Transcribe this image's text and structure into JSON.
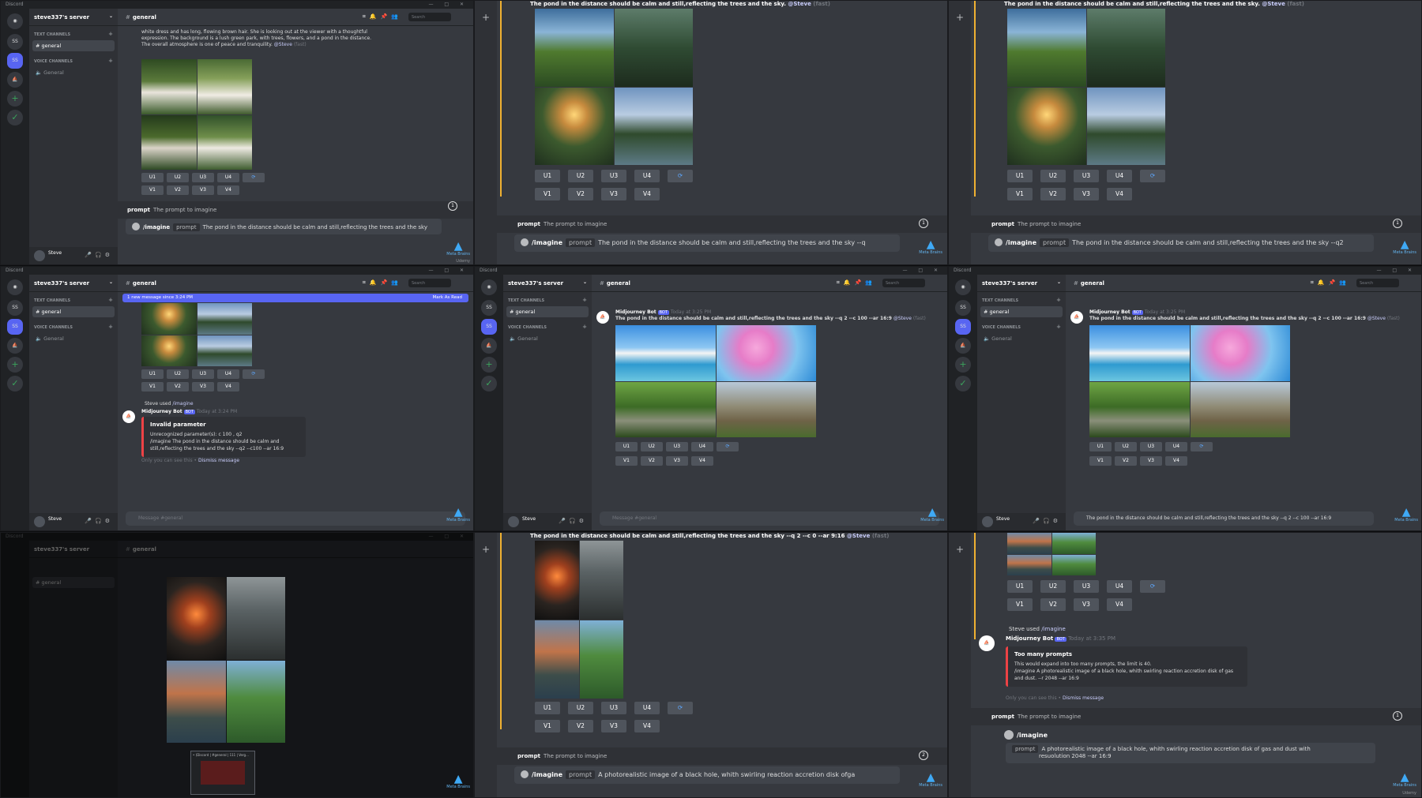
{
  "app_name": "Discord",
  "server": "steve337's server",
  "server_abbr": "SS",
  "channel": "general",
  "categories": {
    "text": "TEXT CHANNELS",
    "voice": "VOICE CHANNELS"
  },
  "voice_channel": "General",
  "user": "Steve",
  "search_placeholder": "Search",
  "buttons": {
    "u": [
      "U1",
      "U2",
      "U3",
      "U4"
    ],
    "v": [
      "V1",
      "V2",
      "V3",
      "V4"
    ]
  },
  "prompt_popup": {
    "label": "prompt",
    "desc": "The prompt to imagine"
  },
  "slash": "/imagine",
  "pill": "prompt",
  "brand": "Meta Brains",
  "udemy": "Udemy",
  "panel1": {
    "msg_text": "white dress and has long, flowing brown hair. She is looking out at the viewer with a thoughtful expression. The background is a lush green park, with trees, flowers, and a pond in the distance. The overall atmosphere is one of peace and tranquility.",
    "mention": "@Steve",
    "speed": "(fast)",
    "input": "The pond in the distance should be calm and still,reflecting the trees and the sky",
    "badge": "1"
  },
  "panel2": {
    "header": "The pond in the distance should be calm and still,reflecting the trees and the sky.",
    "mention": "@Steve",
    "speed": "(fast)",
    "input": "The pond in the distance should be calm and still,reflecting the trees and the sky --q",
    "badge": "1"
  },
  "panel3": {
    "header": "The pond in the distance should be calm and still,reflecting the trees and the sky.",
    "mention": "@Steve",
    "speed": "(fast)",
    "input": "The pond in the distance should be calm and still,reflecting the trees and the sky --q2",
    "badge": "1"
  },
  "panel4": {
    "new_messages": "1 new message since 3:24 PM",
    "mark_read": "Mark As Read",
    "used_by": "Steve used",
    "used_cmd": "/imagine",
    "bot": "Midjourney Bot",
    "bot_badge": "BOT",
    "time": "Today at 3:24 PM",
    "embed_title": "Invalid parameter",
    "embed_line1": "Unrecognized parameter(s): c 100 , q2",
    "embed_line2": "/imagine The pond in the distance should be calm and still,reflecting the trees and the sky --q2 --c100 --ar 16:9",
    "only_you": "Only you can see this •",
    "dismiss": "Dismiss message",
    "msg_placeholder": "Message #general"
  },
  "panel5": {
    "bot": "Midjourney Bot",
    "bot_badge": "BOT",
    "time": "Today at 3:25 PM",
    "text": "The pond in the distance should be calm and still,reflecting the trees and the sky --q 2 --c 100 --ar 16:9",
    "mention": "@Steve",
    "speed": "(fast)",
    "msg_placeholder": "Message #general"
  },
  "panel6": {
    "bot": "Midjourney Bot",
    "bot_badge": "BOT",
    "time": "Today at 3:25 PM",
    "text": "The pond in the distance should be calm and still,reflecting the trees and the sky --q 2 --c 100 --ar 16:9",
    "mention": "@Steve",
    "speed": "(fast)",
    "input": "The pond in the distance should be calm and still,reflecting the trees and the sky --q 2 --c 100 --ar 16:9"
  },
  "panel8": {
    "header": "The pond in the distance should be calm and still,reflecting the trees and the sky --q 2 --c 0 --ar 9:16",
    "mention": "@Steve",
    "speed": "(fast)",
    "input": "A photorealistic image of a black hole, whith swirling reaction accretion disk ofga",
    "badge": "2"
  },
  "panel9": {
    "used_by": "Steve used",
    "used_cmd": "/imagine",
    "bot": "Midjourney Bot",
    "bot_badge": "BOT",
    "time": "Today at 3:35 PM",
    "embed_title": "Too many prompts",
    "embed_line1": "This would expand into too many prompts, the limit is 40.",
    "embed_line2": "/imagine A photorealistic image of a black hole, whith swirling reaction accretion disk of gas and dust. --r 2048 --ar 16:9",
    "only_you": "Only you can see this •",
    "dismiss": "Dismiss message",
    "input_line1": "A photorealistic image of a black hole, whith swirling reaction accretion disk of gas and dust with",
    "input_line2": "resuolution 2048 --ar 16:9",
    "badge": "1"
  },
  "thumb_label": "• (Discord | #general | 111 | Verg..."
}
